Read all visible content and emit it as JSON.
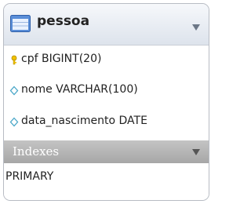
{
  "table": {
    "name": "pessoa",
    "icon": "table-icon",
    "columns": [
      {
        "text": "cpf BIGINT(20)",
        "icon": "primary-key-icon"
      },
      {
        "text": "nome VARCHAR(100)",
        "icon": "nullable-column-icon"
      },
      {
        "text": "data_nascimento DATE",
        "icon": "nullable-column-icon"
      }
    ],
    "indexes_label": "Indexes",
    "indexes": [
      "PRIMARY"
    ]
  },
  "colors": {
    "header_bg": "#dde3ec",
    "indexes_bar_bg": "#b5b5b5",
    "key_icon": "#f2c200",
    "diamond_icon": "#4aa7c8"
  }
}
